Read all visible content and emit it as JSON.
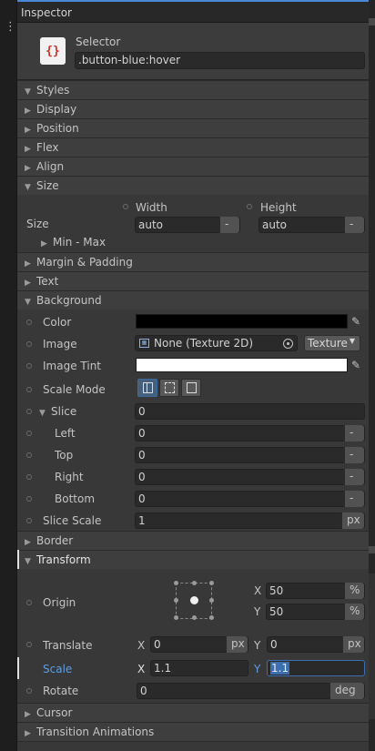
{
  "window": {
    "title": "Inspector"
  },
  "selector": {
    "label": "Selector",
    "value": ".button-blue:hover",
    "icon": "stylesheet-icon"
  },
  "sections": {
    "styles": "Styles",
    "display": "Display",
    "position": "Position",
    "flex": "Flex",
    "align": "Align",
    "size": "Size",
    "margin": "Margin & Padding",
    "text": "Text",
    "background": "Background",
    "border": "Border",
    "transform": "Transform",
    "cursor": "Cursor",
    "transition": "Transition Animations"
  },
  "size": {
    "row_label": "Size",
    "width_label": "Width",
    "height_label": "Height",
    "width_value": "auto",
    "height_value": "auto",
    "unit_dash": "-",
    "minmax_label": "Min - Max"
  },
  "background": {
    "color_label": "Color",
    "color_value": "#000000",
    "image_label": "Image",
    "image_value": "None (Texture 2D)",
    "image_type": "Texture",
    "tint_label": "Image Tint",
    "tint_value": "#ffffff",
    "scale_mode_label": "Scale Mode",
    "slice_label": "Slice",
    "slice_value": "0",
    "left_label": "Left",
    "left_value": "0",
    "top_label": "Top",
    "top_value": "0",
    "right_label": "Right",
    "right_value": "0",
    "bottom_label": "Bottom",
    "bottom_value": "0",
    "dash": "-",
    "slice_scale_label": "Slice Scale",
    "slice_scale_value": "1",
    "slice_scale_unit": "px"
  },
  "transform": {
    "origin_label": "Origin",
    "origin_x_label": "X",
    "origin_x_value": "50",
    "origin_y_label": "Y",
    "origin_y_value": "50",
    "percent": "%",
    "translate_label": "Translate",
    "translate_x_label": "X",
    "translate_x_value": "0",
    "translate_y_label": "Y",
    "translate_y_value": "0",
    "px": "px",
    "scale_label": "Scale",
    "scale_x_label": "X",
    "scale_x_value": "1.1",
    "scale_y_label": "Y",
    "scale_y_value": "1.1",
    "rotate_label": "Rotate",
    "rotate_value": "0",
    "rotate_unit": "deg"
  }
}
